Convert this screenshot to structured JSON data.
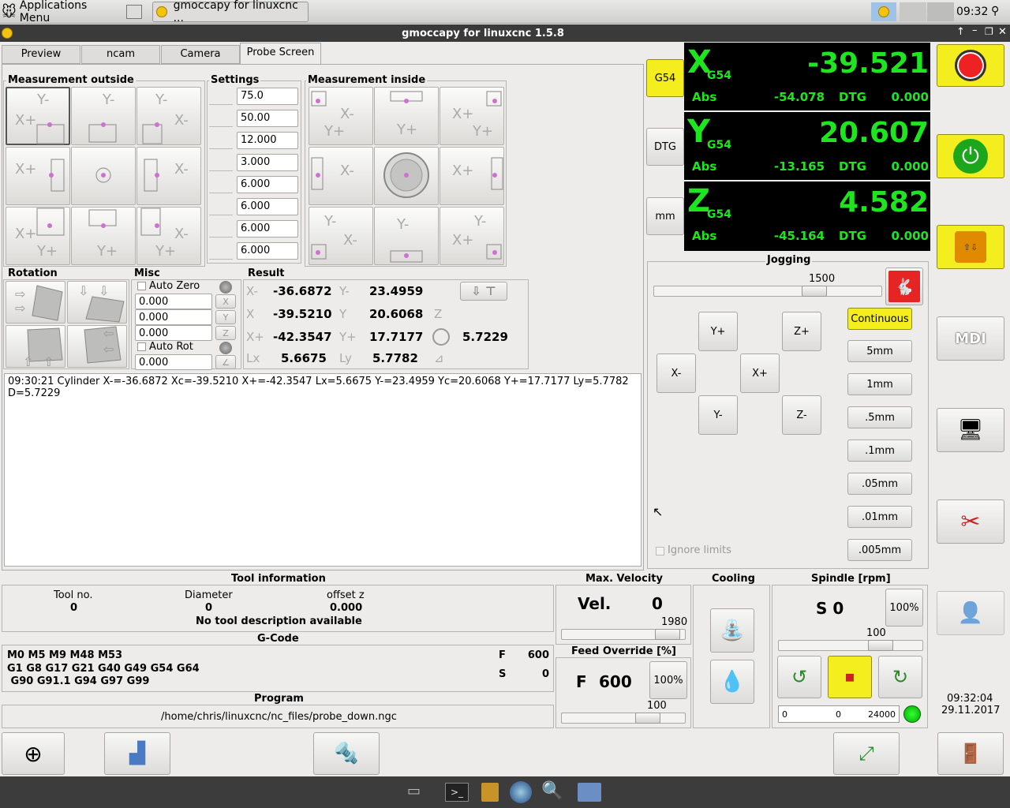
{
  "taskbar": {
    "apps_menu": "Applications Menu",
    "window_tab": "gmoccapy for linuxcnc  ...",
    "clock": "09:32"
  },
  "window": {
    "title": "gmoccapy for linuxcnc  1.5.8"
  },
  "tabs": [
    "Preview",
    "ncam",
    "Camera",
    "Probe Screen"
  ],
  "probe": {
    "outside_title": "Measurement outside",
    "settings_title": "Settings",
    "inside_title": "Measurement inside",
    "settings_values": [
      "75.0",
      "50.00",
      "12.000",
      "3.000",
      "6.000",
      "6.000",
      "6.000",
      "6.000"
    ],
    "rotation_title": "Rotation",
    "misc_title": "Misc",
    "auto_zero": "Auto Zero",
    "misc_values": [
      "0.000",
      "0.000",
      "0.000"
    ],
    "auto_rot": "Auto Rot",
    "auto_rot_value": "0.000",
    "result_title": "Result",
    "result": {
      "xm": "-36.6872",
      "ym": "23.4959",
      "xc": "-39.5210",
      "yc": "20.6068",
      "xp": "-42.3547",
      "yp": "17.7177",
      "d": "5.7229",
      "lx": "5.6675",
      "ly": "5.7782"
    },
    "result_labels": {
      "xm": "X-",
      "ym": "Y-",
      "xc": "X",
      "yc": "Y",
      "xp": "X+",
      "yp": "Y+",
      "lx": "Lx",
      "ly": "Ly"
    },
    "log_line1": "09:30:21  Cylinder  X-=-36.6872 Xc=-39.5210 X+=-42.3547 Lx=5.6675 Y-=23.4959 Yc=20.6068 Y+=17.7177 Ly=5.7782",
    "log_line2": "D=5.7229"
  },
  "dro_buttons": {
    "g54": "G54",
    "dtg": "DTG",
    "mm": "mm"
  },
  "dro": [
    {
      "axis": "X",
      "cs": "G54",
      "value": "-39.521",
      "abs_label": "Abs",
      "abs": "-54.078",
      "dtg_label": "DTG",
      "dtg": "0.000"
    },
    {
      "axis": "Y",
      "cs": "G54",
      "value": "20.607",
      "abs_label": "Abs",
      "abs": "-13.165",
      "dtg_label": "DTG",
      "dtg": "0.000"
    },
    {
      "axis": "Z",
      "cs": "G54",
      "value": "4.582",
      "abs_label": "Abs",
      "abs": "-45.164",
      "dtg_label": "DTG",
      "dtg": "0.000"
    }
  ],
  "jogging": {
    "title": "Jogging",
    "speed": "1500",
    "speed_fraction": 0.73,
    "buttons": {
      "yp": "Y+",
      "zp": "Z+",
      "xm": "X-",
      "xp": "X+",
      "ym": "Y-",
      "zm": "Z-"
    },
    "increments": [
      "Continuous",
      "5mm",
      "1mm",
      ".5mm",
      ".1mm",
      ".05mm",
      ".01mm",
      ".005mm"
    ],
    "ignore_limits": "Ignore limits"
  },
  "sidebar": {
    "mdi_label": "MDI",
    "time": "09:32:04",
    "date": "29.11.2017"
  },
  "tool": {
    "title": "Tool information",
    "no_label": "Tool no.",
    "no": "0",
    "dia_label": "Diameter",
    "dia": "0",
    "off_label": "offset z",
    "off": "0.000",
    "desc": "No tool description available"
  },
  "gcode": {
    "title": "G-Code",
    "line1": "M0 M5 M9 M48 M53",
    "line2": "G1 G8 G17 G21 G40 G49 G54 G64",
    "line3": " G90 G91.1 G94 G97 G99",
    "f_label": "F",
    "f": "600",
    "s_label": "S",
    "s": "0"
  },
  "program": {
    "title": "Program",
    "path": "/home/chris/linuxcnc/nc_files/probe_down.ngc"
  },
  "velocity": {
    "title": "Max. Velocity",
    "label": "Vel.",
    "value": "0",
    "max": "1980",
    "fraction": 0.95
  },
  "feed": {
    "title": "Feed Override [%]",
    "label": "F",
    "value": "600",
    "pct_btn": "100%",
    "scale": "100",
    "fraction": 0.75
  },
  "cooling": {
    "title": "Cooling"
  },
  "spindle": {
    "title": "Spindle [rpm]",
    "value": "S 0",
    "pct_btn": "100%",
    "scale": "100",
    "fraction": 0.75,
    "bar_min": "0",
    "bar_val": "0",
    "bar_max": "24000"
  },
  "colors": {
    "accent": "#f5ee1e",
    "dro_bg": "#000000",
    "dro_fg": "#1ee61e"
  }
}
